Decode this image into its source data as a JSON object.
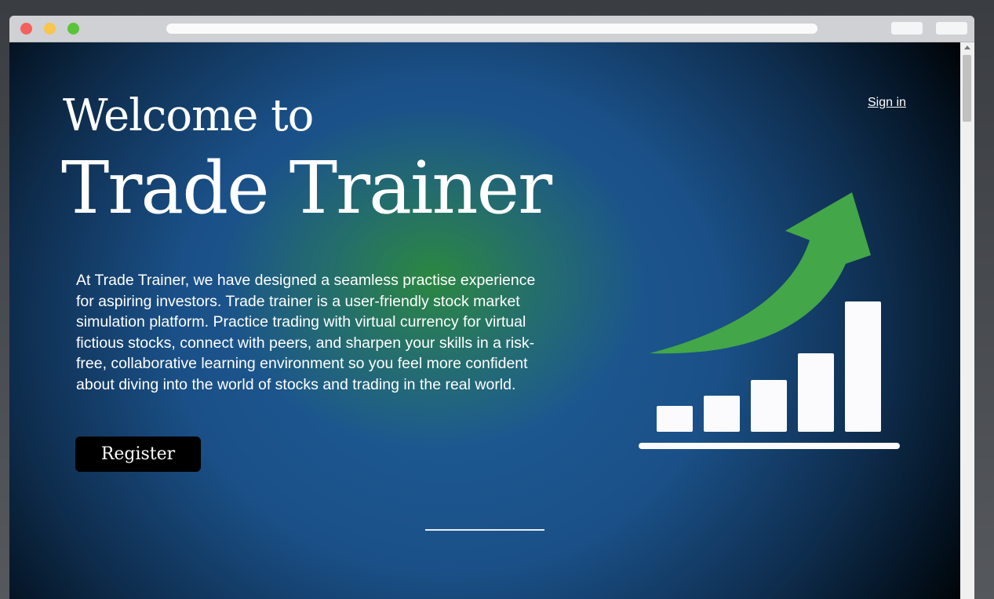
{
  "nav": {
    "sign_in_label": "Sign in"
  },
  "hero": {
    "welcome_text": "Welcome to",
    "brand_name": "Trade Trainer",
    "description": "At Trade Trainer, we have designed a seamless practise experience for aspiring investors. Trade trainer is a user-friendly stock market simulation platform. Practice trading with virtual currency for virtual fictious stocks, connect with peers, and sharpen your skills in a risk-free, collaborative learning environment so you feel more confident about diving into the world of stocks and trading in the real world.",
    "register_label": "Register"
  },
  "illustration": {
    "name": "growth-chart-arrow-icon",
    "bar_levels": [
      0.2,
      0.28,
      0.4,
      0.6,
      1.0
    ],
    "arrow_color": "#43a648",
    "bar_color": "#fbfbfd"
  },
  "colors": {
    "accent_green": "#2c8a3c",
    "accent_blue": "#1f5f98",
    "button_bg": "#000000",
    "text": "#ffffff"
  }
}
